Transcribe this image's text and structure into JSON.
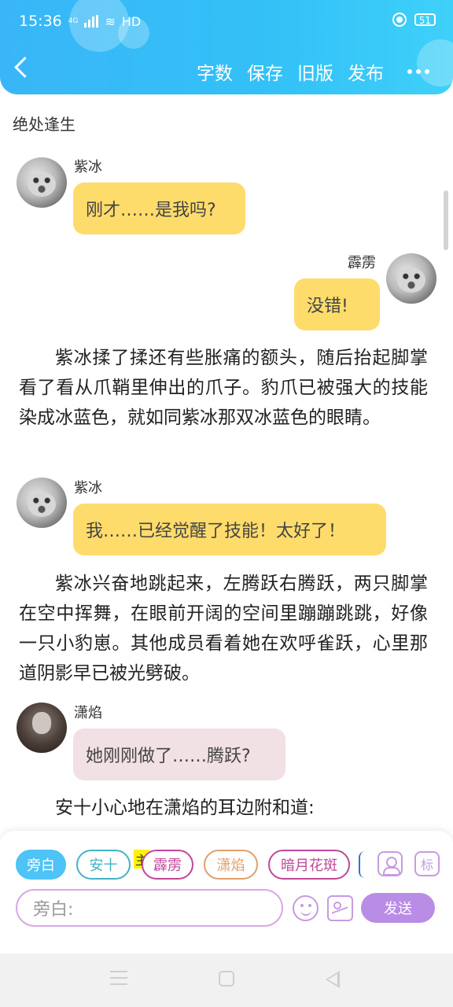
{
  "status_bar": {
    "time": "15:36",
    "network": "4G",
    "wifi_label": "HD",
    "battery": "51",
    "icons": [
      "signal-icon",
      "wifi-icon",
      "record-icon",
      "battery-icon"
    ]
  },
  "header": {
    "back_icon": "chevron-left-icon",
    "actions": [
      "字数",
      "保存",
      "旧版",
      "发布"
    ],
    "more_icon": "more-dots-icon",
    "colors": {
      "gradient_start": "#39b6f7",
      "gradient_end": "#3fd0f9"
    }
  },
  "chapter": {
    "title": "绝处逢生"
  },
  "messages": [
    {
      "speaker": "紫冰",
      "text": "刚才……是我吗?",
      "side": "left",
      "bubble_color": "#fedc6b"
    },
    {
      "speaker": "霹雳",
      "text": "没错!",
      "side": "right",
      "bubble_color": "#fedc6b"
    },
    {
      "narration": "紫冰揉了揉还有些胀痛的额头，随后抬起脚掌看了看从爪鞘里伸出的爪子。豹爪已被强大的技能染成冰蓝色，就如同紫冰那双冰蓝色的眼睛。"
    },
    {
      "speaker": "紫冰",
      "text": "我……已经觉醒了技能！太好了！",
      "side": "left",
      "bubble_color": "#fedc6b"
    },
    {
      "narration": "紫冰兴奋地跳起来，左腾跃右腾跃，两只脚掌在空中挥舞，在眼前开阔的空间里蹦蹦跳跳，好像一只小豹崽。其他成员看着她在欢呼雀跃，心里那道阴影早已被光劈破。"
    },
    {
      "speaker": "潇焰",
      "text": "她刚刚做了……腾跃?",
      "side": "left",
      "bubble_color": "#f1e0e4"
    },
    {
      "narration": "安十小心地在潇焰的耳边附和道:"
    }
  ],
  "composer": {
    "characters": [
      {
        "label": "旁白",
        "active": true,
        "color": "#4dc3f7"
      },
      {
        "label": "安十",
        "active": false,
        "color": "#43b3c6"
      },
      {
        "label": "霹雳",
        "active": false,
        "color": "#c0479a",
        "badge": "主"
      },
      {
        "label": "潇焰",
        "active": false,
        "color": "#e0a06a"
      },
      {
        "label": "暗月花斑",
        "active": false,
        "color": "#c0479a"
      }
    ],
    "tool_icons": [
      "user-card-icon",
      "tag-icon",
      "emoji-icon",
      "image-icon"
    ],
    "input_placeholder": "旁白:",
    "send_label": "发送",
    "send_color": "#b98de6"
  },
  "system_nav": {
    "icons": [
      "menu-icon",
      "home-icon",
      "back-triangle-icon"
    ]
  }
}
